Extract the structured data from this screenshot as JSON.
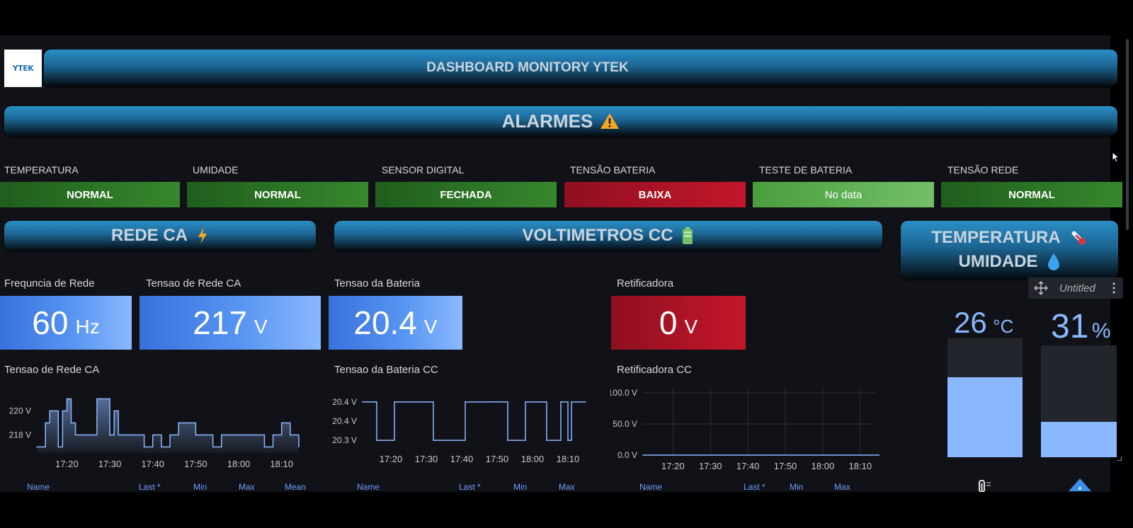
{
  "header": {
    "logo_text": "YTEK",
    "title": "DASHBOARD MONITORY YTEK"
  },
  "alarms_section": {
    "title": "ALARMES"
  },
  "alarms": [
    {
      "label": "TEMPERATURA",
      "status": "NORMAL"
    },
    {
      "label": "UMIDADE",
      "status": "NORMAL"
    },
    {
      "label": "SENSOR DIGITAL",
      "status": "FECHADA"
    },
    {
      "label": "TENSÃO BATERIA",
      "status": "BAIXA"
    },
    {
      "label": "TESTE DE BATERIA",
      "status": "No data"
    },
    {
      "label": "TENSÃO REDE",
      "status": "NORMAL"
    }
  ],
  "sections": {
    "rede_ca": "REDE CA",
    "voltimetros": "VOLTIMETROS CC",
    "temperatura": "TEMPERATURA",
    "umidade": "UMIDADE"
  },
  "stats": [
    {
      "title": "Frequncia de Rede",
      "value": "60",
      "unit": "Hz"
    },
    {
      "title": "Tensao de Rede CA",
      "value": "217",
      "unit": "V"
    },
    {
      "title": "Tensao da Bateria",
      "value": "20.4",
      "unit": "V"
    },
    {
      "title": "Retificadora",
      "value": "0",
      "unit": "V"
    }
  ],
  "charts": {
    "rede": {
      "title": "Tensao de Rede CA",
      "y_ticks": [
        "220 V",
        "218 V"
      ],
      "x_ticks": [
        "17:20",
        "17:30",
        "17:40",
        "17:50",
        "18:00",
        "18:10"
      ],
      "legend": [
        "Name",
        "Last *",
        "Min",
        "Max",
        "Mean"
      ]
    },
    "bateria": {
      "title": "Tensao da Bateria CC",
      "y_ticks": [
        "20.4 V",
        "20.4 V",
        "20.3 V"
      ],
      "x_ticks": [
        "17:20",
        "17:30",
        "17:40",
        "17:50",
        "18:00",
        "18:10"
      ],
      "legend": [
        "Name",
        "Last *",
        "Min",
        "Max"
      ]
    },
    "retificadora": {
      "title": "Retificadora CC",
      "y_ticks": [
        "100.0 V",
        "50.0 V",
        "0.0 V"
      ],
      "x_ticks": [
        "17:20",
        "17:30",
        "17:40",
        "17:50",
        "18:00",
        "18:10"
      ],
      "legend": [
        "Name",
        "Last *",
        "Min",
        "Max"
      ]
    }
  },
  "chart_data": [
    {
      "type": "area",
      "title": "Tensao de Rede CA",
      "x": [
        "17:13",
        "17:15",
        "17:16",
        "17:18",
        "17:19",
        "17:20",
        "17:21",
        "17:22",
        "17:24",
        "17:26",
        "17:27",
        "17:28",
        "17:30",
        "17:31",
        "17:32",
        "17:34",
        "17:36",
        "17:38",
        "17:40",
        "17:42",
        "17:44",
        "17:46",
        "17:48",
        "17:50",
        "17:52",
        "17:54",
        "17:56",
        "17:58",
        "18:00",
        "18:02",
        "18:04",
        "18:06",
        "18:08",
        "18:10",
        "18:12",
        "18:14"
      ],
      "values": [
        217,
        219,
        220,
        217,
        220,
        221,
        219,
        218,
        218,
        218,
        221,
        221,
        218,
        220,
        218,
        218,
        218,
        217,
        218,
        217,
        218,
        219,
        219,
        218,
        218,
        217,
        218,
        218,
        218,
        218,
        218,
        217,
        218,
        219,
        218,
        217
      ],
      "y_ticks": [
        218,
        220
      ],
      "unit": "V"
    },
    {
      "type": "line",
      "title": "Tensao da Bateria CC",
      "x": [
        "17:12",
        "17:15",
        "17:16",
        "17:20",
        "17:21",
        "17:31",
        "17:32",
        "17:40",
        "17:41",
        "17:49",
        "17:50",
        "17:52",
        "17:53",
        "17:56",
        "17:58",
        "18:03",
        "18:04",
        "18:07",
        "18:08",
        "18:10",
        "18:11",
        "18:15"
      ],
      "values": [
        20.4,
        20.4,
        20.3,
        20.3,
        20.4,
        20.4,
        20.3,
        20.3,
        20.4,
        20.4,
        20.4,
        20.4,
        20.3,
        20.3,
        20.4,
        20.4,
        20.3,
        20.3,
        20.4,
        20.3,
        20.4,
        20.4
      ],
      "y_ticks": [
        20.3,
        20.4,
        20.4
      ],
      "unit": "V"
    },
    {
      "type": "line",
      "title": "Retificadora CC",
      "x": [
        "17:12",
        "18:17"
      ],
      "values": [
        0,
        0
      ],
      "ylim": [
        0,
        100
      ],
      "y_ticks": [
        0,
        50,
        100
      ],
      "unit": "V",
      "grid": true
    }
  ],
  "untitled_panel": {
    "label": "Untitled"
  },
  "gauges": {
    "temperature": {
      "value": "26",
      "unit": "°C",
      "fill_fraction": 0.67
    },
    "humidity": {
      "value": "31",
      "unit": "%",
      "fill_fraction": 0.31
    }
  },
  "colors": {
    "green": "#37872d",
    "light_green": "#73bf69",
    "red": "#c4162a",
    "blue": "#5794f2",
    "gauge_fill": "#8ab8ff",
    "background": "#111217"
  }
}
